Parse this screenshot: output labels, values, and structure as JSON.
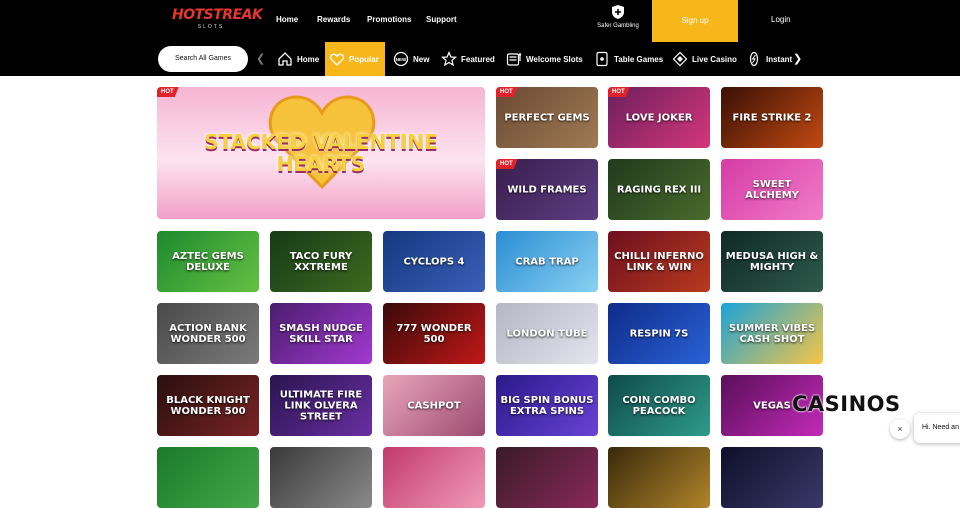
{
  "brand": {
    "logo_main": "HOTSTREAK",
    "logo_sub": "SLOTS"
  },
  "header": {
    "links": [
      "Home",
      "Rewards",
      "Promotions",
      "Support"
    ],
    "safer_gambling": "Safer Gambling",
    "signup": "Sign up",
    "login": "Login"
  },
  "subnav": {
    "search": "Search All Games",
    "categories": [
      "Home",
      "Popular",
      "New",
      "Featured",
      "Welcome Slots",
      "Table Games",
      "Live Casino",
      "Instant"
    ],
    "active_category": "Popular"
  },
  "badge": "HOT",
  "featured_game": {
    "name": "STACKED VALENTINE HEARTS",
    "hot": true
  },
  "games": [
    {
      "name": "PERFECT GEMS",
      "hot": true
    },
    {
      "name": "LOVE JOKER",
      "hot": true
    },
    {
      "name": "FIRE STRIKE 2",
      "hot": false
    },
    {
      "name": "WILD FRAMES",
      "hot": true
    },
    {
      "name": "RAGING REX III",
      "hot": false
    },
    {
      "name": "SWEET ALCHEMY",
      "hot": false
    },
    {
      "name": "AZTEC GEMS DELUXE",
      "hot": false
    },
    {
      "name": "TACO FURY XXTREME",
      "hot": false
    },
    {
      "name": "CYCLOPS 4",
      "hot": false
    },
    {
      "name": "CRAB TRAP",
      "hot": false
    },
    {
      "name": "CHILLI INFERNO LINK & WIN",
      "hot": false
    },
    {
      "name": "MEDUSA HIGH & MIGHTY",
      "hot": false
    },
    {
      "name": "ACTION BANK WONDER 500",
      "hot": false
    },
    {
      "name": "SMASH NUDGE SKILL STAR",
      "hot": false
    },
    {
      "name": "777 WONDER 500",
      "hot": false
    },
    {
      "name": "LONDON TUBE",
      "hot": false
    },
    {
      "name": "RESPIN 7S",
      "hot": false
    },
    {
      "name": "SUMMER VIBES CASH SHOT",
      "hot": false
    },
    {
      "name": "BLACK KNIGHT WONDER 500",
      "hot": false
    },
    {
      "name": "ULTIMATE FIRE LINK OLVERA STREET",
      "hot": false
    },
    {
      "name": "CASHPOT",
      "hot": false
    },
    {
      "name": "BIG SPIN BONUS EXTRA SPINS",
      "hot": false
    },
    {
      "name": "COIN COMBO PEACOCK",
      "hot": false
    },
    {
      "name": "VEGAS",
      "hot": false
    },
    {
      "name": "",
      "hot": false
    },
    {
      "name": "",
      "hot": false
    },
    {
      "name": "",
      "hot": false
    },
    {
      "name": "",
      "hot": false
    },
    {
      "name": "",
      "hot": false
    },
    {
      "name": "",
      "hot": false
    }
  ],
  "watermark": "CASINOS",
  "chat": {
    "close_icon": "×",
    "preview": "Hi. Need an"
  },
  "colors": {
    "accent": "#f7b61a",
    "hot_badge": "#e0222b",
    "header_bg": "#000000"
  }
}
